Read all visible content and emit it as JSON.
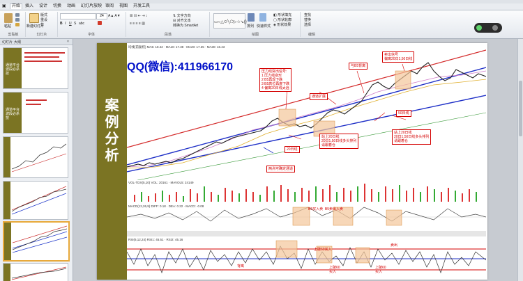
{
  "ribbon": {
    "tabs": [
      "开始",
      "插入",
      "设计",
      "切换",
      "动画",
      "幻灯片放映",
      "审阅",
      "视图",
      "开发工具"
    ],
    "active_tab": "开始",
    "groups": {
      "clipboard": "剪贴板",
      "slides": "幻灯片",
      "font": "字体",
      "paragraph": "段落",
      "drawing": "绘图",
      "editing": "编辑"
    },
    "buttons": {
      "paste": "粘贴",
      "new_slide": "新建幻灯片",
      "layout": "版式",
      "reset": "重设",
      "section": "节",
      "smartart": "转换为 SmartArt",
      "arrange": "排列",
      "quick_styles": "快速样式",
      "find": "查找",
      "replace": "替换",
      "select": "选择"
    },
    "font_size": "24"
  },
  "left_pane": {
    "tabs": [
      "幻灯片",
      "大纲"
    ],
    "thumbnails": [
      {
        "num": "",
        "title": "通道平台波段必杀技"
      },
      {
        "num": "",
        "title": "通道平台波段必杀技"
      },
      {
        "num": "",
        "title": ""
      },
      {
        "num": "",
        "title": ""
      },
      {
        "num": "",
        "title": ""
      },
      {
        "num": "",
        "title": ""
      }
    ]
  },
  "slide": {
    "band_text": [
      "案",
      "例",
      "分",
      "析"
    ],
    "watermark": "QQ(微信):411966170",
    "annotations": {
      "top_box": "压力线突出信号:\n1 压力线变形\n2 B5再现下跌\n3 B5高位再度下跌\n4 偏离20日线太远",
      "box2": "通道扩展",
      "box3": "与B5背离",
      "box4": "卖出信号\n偏离20日1,50日线",
      "mid1": "20日线",
      "mid2": "站上20日线\n20日1,50日线多头排列\n请跟着仓",
      "mid3": "50日线",
      "mid4": "站上20日线\n20日1,50日线多头排列\n请跟着仓",
      "low1": "两点可确定通道",
      "vol": "B5买入卖  B5卖出入卖",
      "back1": "背离",
      "back2": "上破60买入",
      "back3": "卖出",
      "back4": "上破60\n买入",
      "back5": "上破60\n买入"
    },
    "indicator_labels": {
      "ma": "均线(前复权) MA5: 18.42 · MA10: 17.38 · MA20: 17.35 · MA30: 16.43",
      "volume": "VOL-TDX(5,10) VOL: 20161 · MAVOL5: 24149",
      "macd": "MACD(12,26,9) DIFF: 0.18 · DEA: 0.22 · MACD: -0.08",
      "rsi": "RSI(6,12,24) RSI1: 45.51 · RSI2: 45.16"
    }
  }
}
